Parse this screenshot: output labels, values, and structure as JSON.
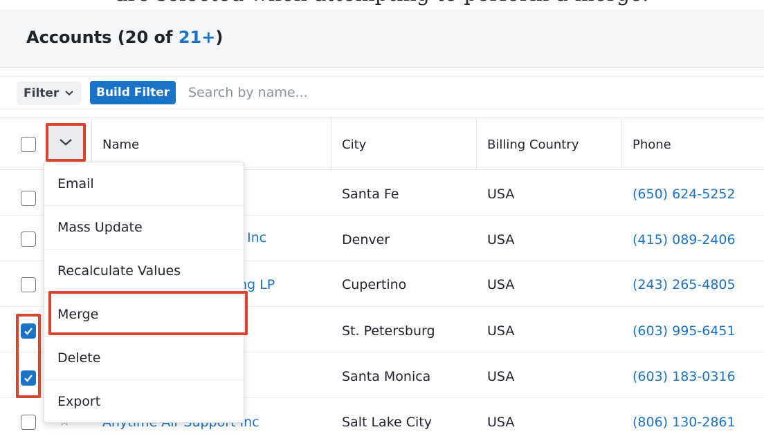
{
  "document": {
    "text_above": "are selected when attempting to perform a merge."
  },
  "header": {
    "title_prefix": "Accounts (20 of ",
    "title_more": "21+",
    "title_suffix": ")"
  },
  "filterbar": {
    "filter_label": "Filter",
    "build_filter_label": "Build Filter",
    "search_placeholder": "Search by name..."
  },
  "table": {
    "columns": [
      "Name",
      "City",
      "Billing Country",
      "Phone"
    ],
    "rows": [
      {
        "name": "",
        "city": "Santa Fe",
        "country": "USA",
        "phone": "(650) 624-5252",
        "checked": false
      },
      {
        "name": "Inc",
        "city": "Denver",
        "country": "USA",
        "phone": "(415) 089-2406",
        "checked": false
      },
      {
        "name": "ng LP",
        "city": "Cupertino",
        "country": "USA",
        "phone": "(243) 265-4805",
        "checked": false
      },
      {
        "name": "",
        "city": "St. Petersburg",
        "country": "USA",
        "phone": "(603) 995-6451",
        "checked": true
      },
      {
        "name": "",
        "city": "Santa Monica",
        "country": "USA",
        "phone": "(603) 183-0316",
        "checked": true
      },
      {
        "name": "Anytime Air Support Inc",
        "city": "Salt Lake City",
        "country": "USA",
        "phone": "(806) 130-2861",
        "checked": false
      }
    ]
  },
  "menu": {
    "items": [
      "Email",
      "Mass Update",
      "Recalculate Values",
      "Merge",
      "Delete",
      "Export"
    ]
  },
  "colors": {
    "accent": "#1a73c7",
    "highlight": "#d9442f"
  }
}
